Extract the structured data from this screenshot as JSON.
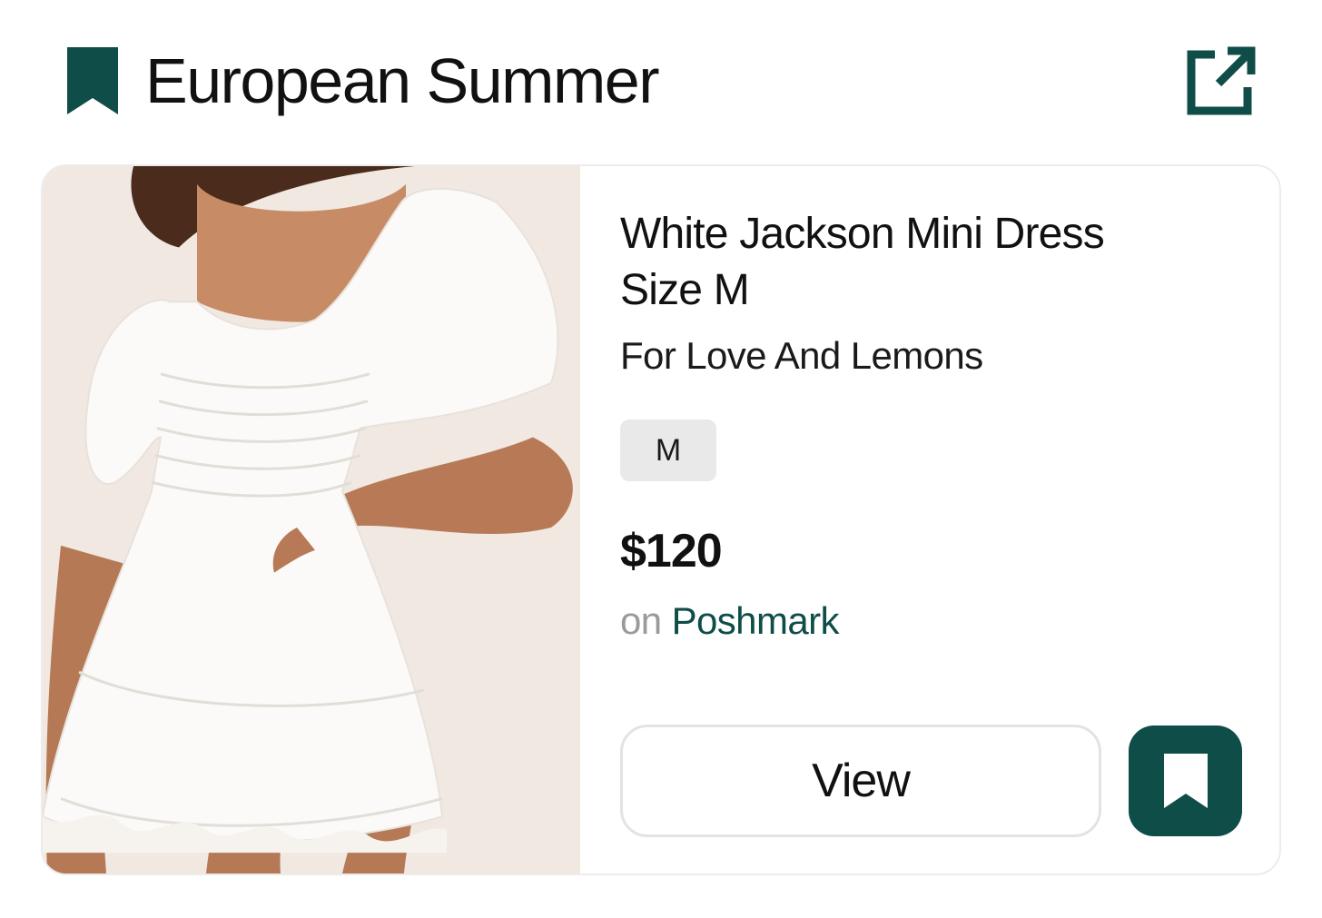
{
  "header": {
    "title": "European Summer",
    "icon": "bookmark-icon",
    "action_icon": "external-link-icon"
  },
  "product": {
    "image_description_icon": "product-photo",
    "title_line1": "White Jackson Mini Dress",
    "title_line2": "Size M",
    "brand": "For Love And Lemons",
    "size": "M",
    "price": "$120",
    "source_prefix": "on",
    "source_name": "Poshmark"
  },
  "actions": {
    "view_label": "View",
    "save_icon": "bookmark-icon"
  },
  "colors": {
    "accent": "#0f4d48",
    "muted_text": "#9a9a9a",
    "chip_bg": "#e9e9e9",
    "border": "#e3e3e3"
  }
}
